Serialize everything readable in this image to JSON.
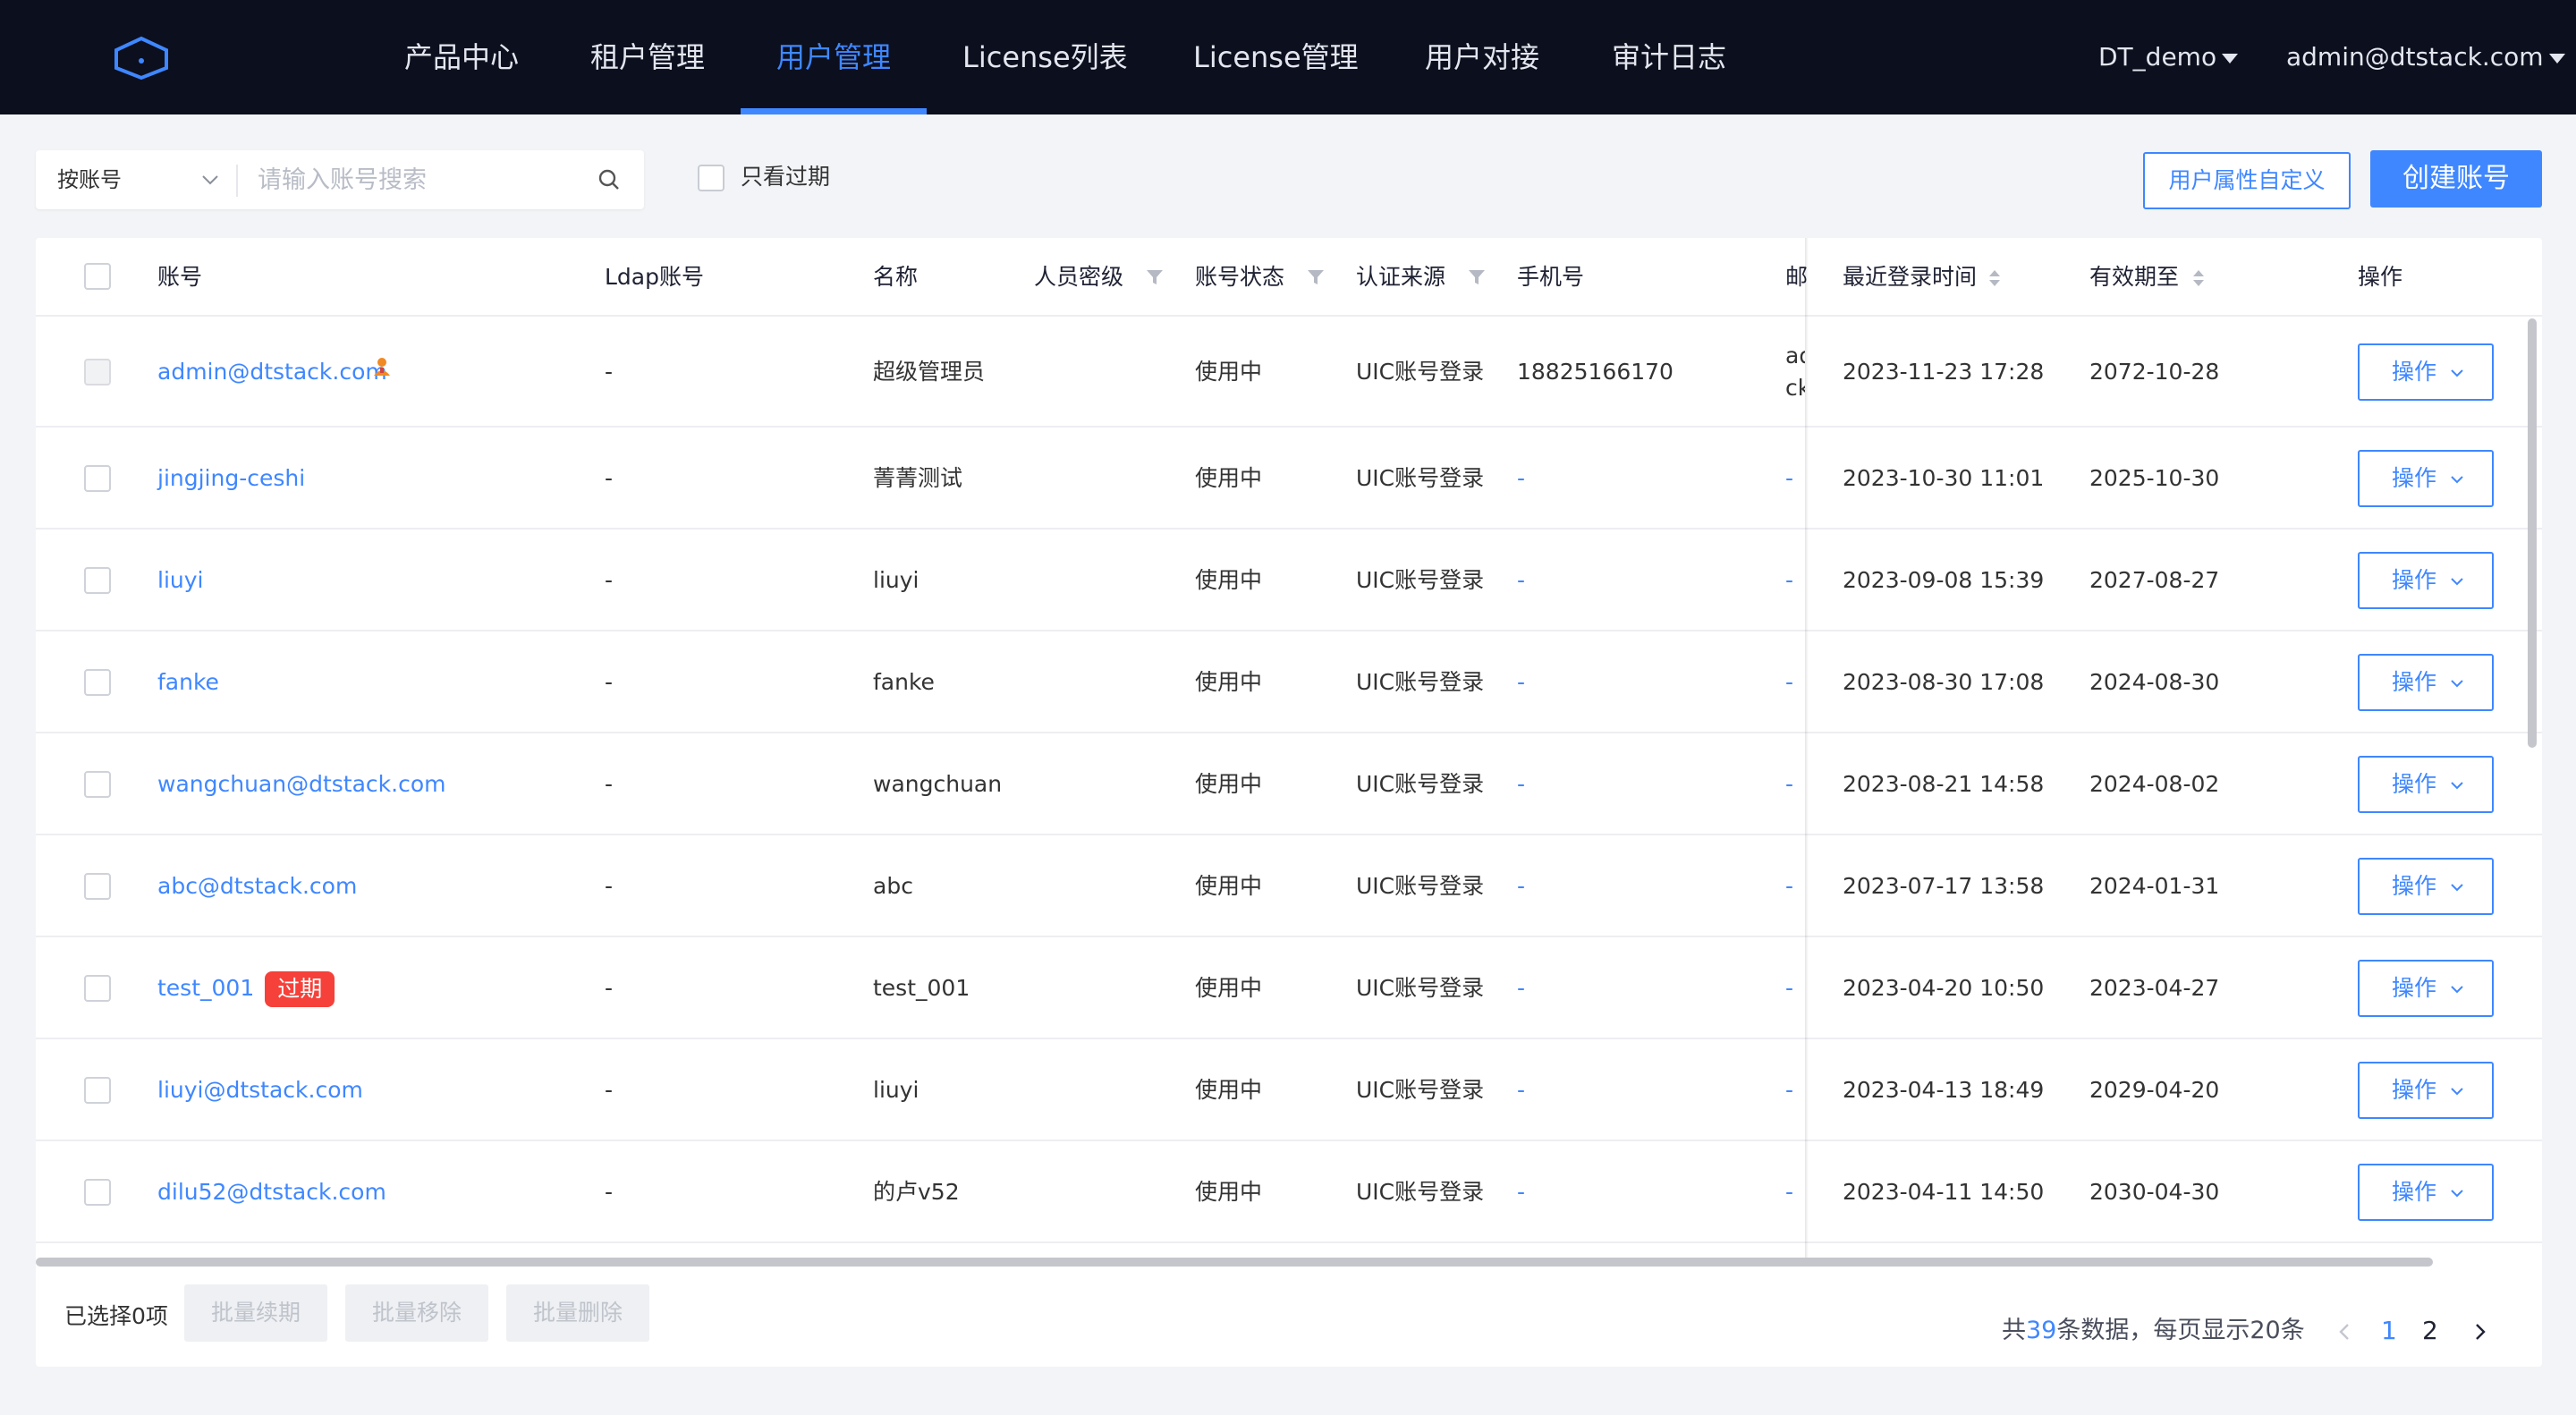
{
  "nav": {
    "items": [
      "产品中心",
      "租户管理",
      "用户管理",
      "License列表",
      "License管理",
      "用户对接",
      "审计日志"
    ],
    "active": "用户管理",
    "tenant": "DT_demo",
    "user": "admin@dtstack.com"
  },
  "filter": {
    "search_type": "按账号",
    "search_placeholder": "请输入账号搜索",
    "only_expired_label": "只看过期",
    "custom_attr_button": "用户属性自定义",
    "create_button": "创建账号"
  },
  "table": {
    "columns": {
      "account": "账号",
      "ldap": "Ldap账号",
      "name": "名称",
      "level": "人员密级",
      "status": "账号状态",
      "auth": "认证来源",
      "phone": "手机号",
      "email": "邮",
      "last_login": "最近登录时间",
      "valid_until": "有效期至",
      "action": "操作"
    },
    "rows": [
      {
        "account": "admin@dtstack.com",
        "ldap": "-",
        "name": "超级管理员",
        "status": "使用中",
        "auth": "UIC账号登录",
        "phone": "18825166170",
        "email": "ad\nck",
        "last_login": "2023-11-23 17:28",
        "valid_until": "2072-10-28",
        "action": "操作"
      },
      {
        "account": "jingjing-ceshi",
        "ldap": "-",
        "name": "菁菁测试",
        "status": "使用中",
        "auth": "UIC账号登录",
        "phone": "-",
        "email": "-",
        "last_login": "2023-10-30 11:01",
        "valid_until": "2025-10-30",
        "action": "操作"
      },
      {
        "account": "liuyi",
        "ldap": "-",
        "name": "liuyi",
        "status": "使用中",
        "auth": "UIC账号登录",
        "phone": "-",
        "email": "-",
        "last_login": "2023-09-08 15:39",
        "valid_until": "2027-08-27",
        "action": "操作"
      },
      {
        "account": "fanke",
        "ldap": "-",
        "name": "fanke",
        "status": "使用中",
        "auth": "UIC账号登录",
        "phone": "-",
        "email": "-",
        "last_login": "2023-08-30 17:08",
        "valid_until": "2024-08-30",
        "action": "操作"
      },
      {
        "account": "wangchuan@dtstack.com",
        "ldap": "-",
        "name": "wangchuan",
        "status": "使用中",
        "auth": "UIC账号登录",
        "phone": "-",
        "email": "-",
        "last_login": "2023-08-21 14:58",
        "valid_until": "2024-08-02",
        "action": "操作"
      },
      {
        "account": "abc@dtstack.com",
        "ldap": "-",
        "name": "abc",
        "status": "使用中",
        "auth": "UIC账号登录",
        "phone": "-",
        "email": "-",
        "last_login": "2023-07-17 13:58",
        "valid_until": "2024-01-31",
        "action": "操作"
      },
      {
        "account": "test_001",
        "expired_tag": "过期",
        "ldap": "-",
        "name": "test_001",
        "status": "使用中",
        "auth": "UIC账号登录",
        "phone": "-",
        "email": "-",
        "last_login": "2023-04-20 10:50",
        "valid_until": "2023-04-27",
        "action": "操作"
      },
      {
        "account": "liuyi@dtstack.com",
        "ldap": "-",
        "name": "liuyi",
        "status": "使用中",
        "auth": "UIC账号登录",
        "phone": "-",
        "email": "-",
        "last_login": "2023-04-13 18:49",
        "valid_until": "2029-04-20",
        "action": "操作"
      },
      {
        "account": "dilu52@dtstack.com",
        "ldap": "-",
        "name": "的卢v52",
        "status": "使用中",
        "auth": "UIC账号登录",
        "phone": "-",
        "email": "-",
        "last_login": "2023-04-11 14:50",
        "valid_until": "2030-04-30",
        "action": "操作"
      }
    ]
  },
  "footer": {
    "selected_text": "已选择0项",
    "bulk_renew": "批量续期",
    "bulk_remove": "批量移除",
    "bulk_delete": "批量删除",
    "total_prefix": "共",
    "total_count": "39",
    "total_suffix": "条数据，每页显示20条",
    "pages": [
      "1",
      "2"
    ],
    "current_page": "1"
  },
  "colors": {
    "primary": "#3f87ff",
    "nav_bg": "#0c0f1e",
    "danger": "#f5413a"
  },
  "icons": [
    "logo-icon",
    "caret-down-icon",
    "chevron-down-icon",
    "search-icon",
    "filter-icon",
    "sort-icon",
    "admin-user-icon",
    "chevron-left-icon",
    "chevron-right-icon"
  ]
}
